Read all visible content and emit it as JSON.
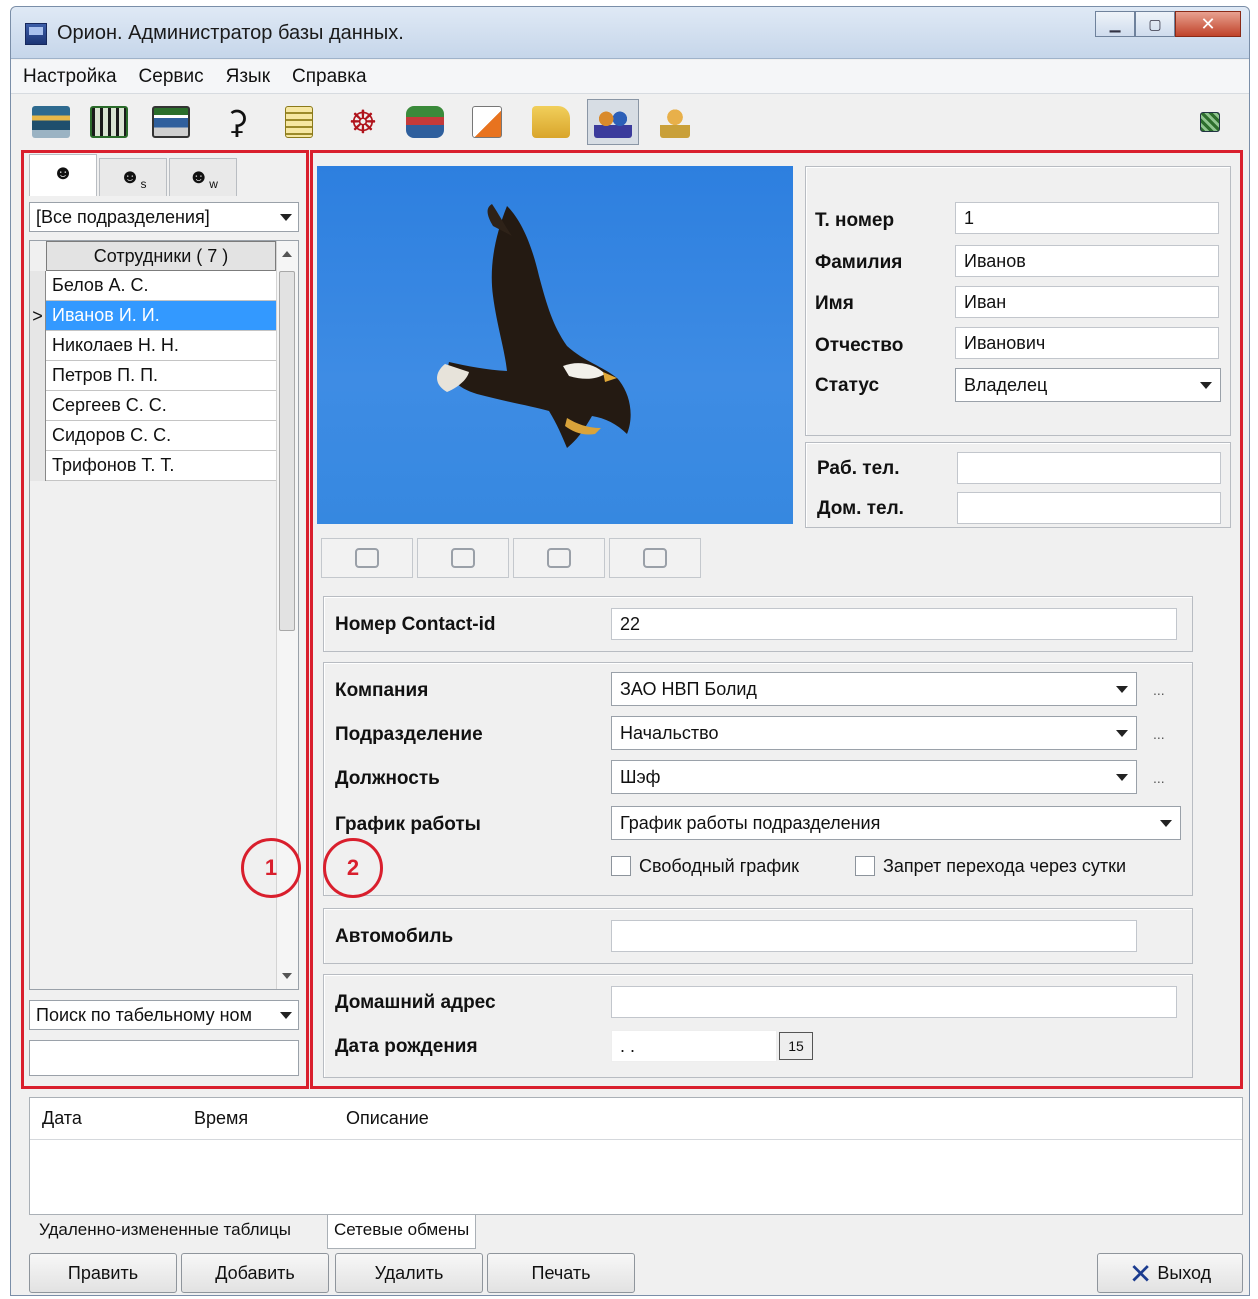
{
  "window": {
    "title": "Орион. Администратор базы данных.",
    "controls": [
      "minimize-icon",
      "maximize-icon",
      "close-icon"
    ]
  },
  "menu": [
    "Настройка",
    "Сервис",
    "Язык",
    "Справка"
  ],
  "toolbar": {
    "icons": [
      "employees-db-icon",
      "building-icon",
      "server-icon",
      "antenna-icon",
      "notes-icon",
      "wheel-icon",
      "calendar-train-icon",
      "report-icon",
      "folder-users-icon",
      "users-icon",
      "keys-user-icon",
      "connection-status-icon"
    ],
    "active_index": 9
  },
  "left_panel": {
    "tabs": [
      {
        "icon": "user-icon",
        "suffix": ""
      },
      {
        "icon": "user-icon",
        "suffix": "s"
      },
      {
        "icon": "user-icon",
        "suffix": "w"
      }
    ],
    "department_filter": "[Все подразделения]",
    "grid_header": "Сотрудники  ( 7 )",
    "employees": [
      "Белов А. С.",
      "Иванов И. И.",
      "Николаев Н. Н.",
      "Петров П. П.",
      "Сергеев С. С.",
      "Сидоров С. С.",
      "Трифонов Т. Т."
    ],
    "selected_index": 1,
    "current_row_marker": ">",
    "search_mode": "Поиск по табельному ном",
    "search_value": "",
    "callout": "1"
  },
  "right_panel": {
    "callout": "2",
    "photo_buttons": [
      "camera-icon",
      "scanner-icon",
      "edit-photo-icon",
      "clear-photo-icon"
    ],
    "personal": {
      "tab_number_label": "Т. номер",
      "tab_number": "1",
      "surname_label": "Фамилия",
      "surname": "Иванов",
      "name_label": "Имя",
      "name": "Иван",
      "patronymic_label": "Отчество",
      "patronymic": "Иванович",
      "status_label": "Статус",
      "status": "Владелец"
    },
    "phones": {
      "work_label": "Раб. тел.",
      "work": "",
      "home_label": "Дом. тел.",
      "home": ""
    },
    "contact": {
      "label": "Номер Contact-id",
      "value": "22"
    },
    "org": {
      "company_label": "Компания",
      "company": "ЗАО НВП Болид",
      "department_label": "Подразделение",
      "department": "Начальство",
      "position_label": "Должность",
      "position": "Шэф",
      "schedule_label": "График работы",
      "schedule": "График работы подразделения",
      "free_schedule": "Свободный график",
      "free_schedule_checked": false,
      "no_overnight": "Запрет перехода через сутки",
      "no_overnight_checked": false,
      "ellipsis": "..."
    },
    "car": {
      "label": "Автомобиль",
      "value": ""
    },
    "address": {
      "label": "Домашний адрес",
      "value": ""
    },
    "birthdate": {
      "label": "Дата рождения",
      "value": ". .",
      "calendar": "15"
    }
  },
  "log": {
    "columns": [
      "Дата",
      "Время",
      "Описание"
    ],
    "tabs": [
      "Удаленно-измененные таблицы",
      "Сетевые обмены"
    ],
    "selected_tab": 1
  },
  "buttons": {
    "edit": "Править",
    "add": "Добавить",
    "delete": "Удалить",
    "print": "Печать",
    "exit": "Выход"
  },
  "colors": {
    "highlight": "#d91f2d",
    "selection": "#3399ff",
    "photo_sky": "#2d7fdf"
  }
}
